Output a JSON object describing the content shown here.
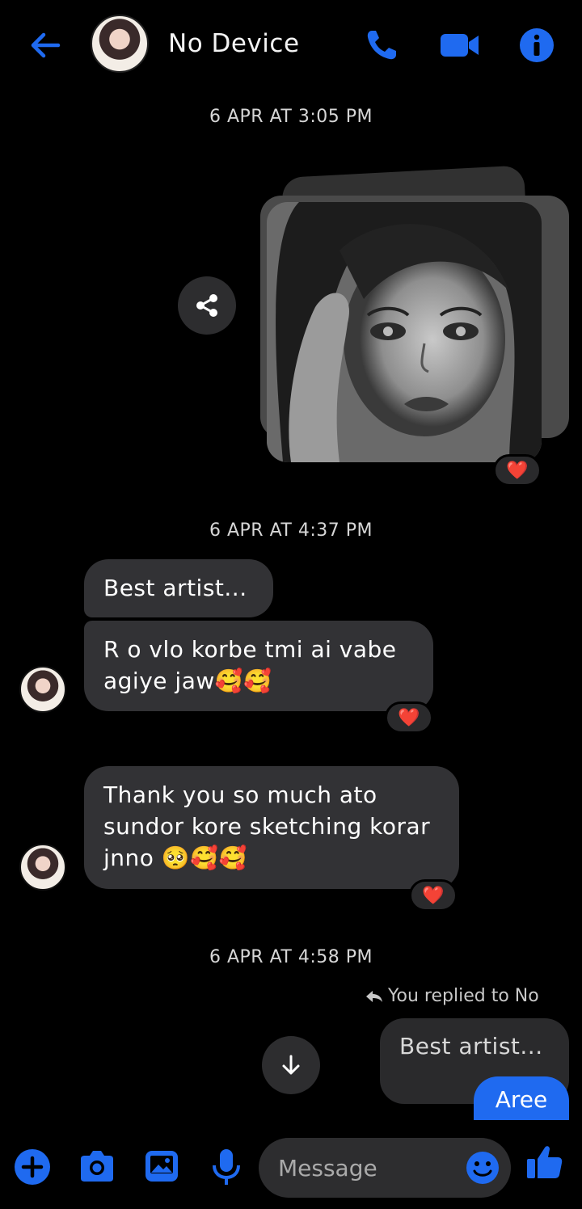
{
  "header": {
    "title": "No Device",
    "icons": {
      "back": "arrow-left-icon",
      "call": "phone-icon",
      "video": "video-camera-icon",
      "info": "info-icon"
    }
  },
  "colors": {
    "accent": "#1f6af0",
    "bubble": "#323235",
    "background": "#000000",
    "heart": "#e8202e"
  },
  "timestamps": [
    "6 APR AT 3:05 PM",
    "6 APR AT 4:37 PM",
    "6 APR AT 4:58 PM"
  ],
  "messages": [
    {
      "text": "Best artist..."
    },
    {
      "text": "R o vlo korbe tmi ai vabe agiye jaw🥰🥰"
    },
    {
      "text": "Thank you so much ato sundor kore sketching korar jnno 🥺🥰🥰"
    }
  ],
  "reply": {
    "indicator": "You replied to No",
    "quoted": "Best artist...",
    "sent_text": "Aree"
  },
  "reactions": [
    "❤️",
    "❤️",
    "❤️"
  ],
  "composer": {
    "placeholder": "Message",
    "icons": [
      "plus-icon",
      "camera-icon",
      "gallery-icon",
      "microphone-icon",
      "emoji-icon",
      "thumbs-up-icon"
    ]
  }
}
